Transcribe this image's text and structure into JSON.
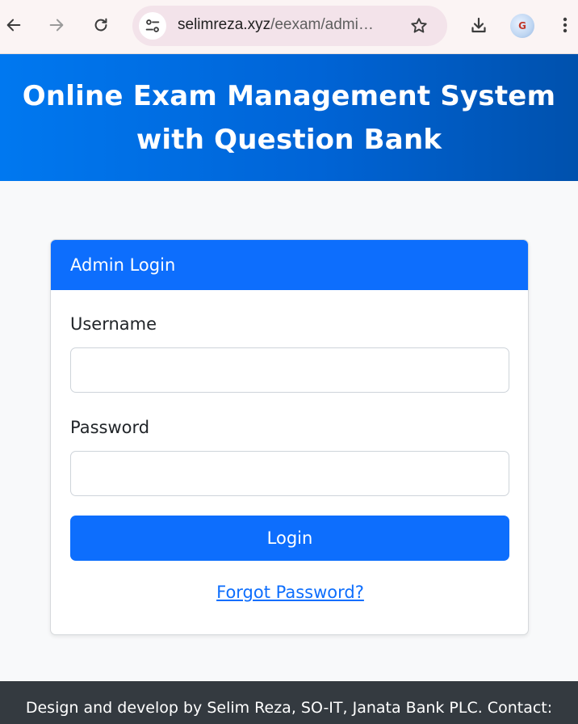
{
  "browser": {
    "url_host": "selimreza.xyz",
    "url_path": "/eexam/admi…",
    "icons": {
      "back": "arrow-left-icon",
      "forward": "arrow-right-icon",
      "reload": "reload-icon",
      "site_info": "tune-icon",
      "bookmark": "star-icon",
      "download": "download-icon",
      "extension": "extension-icon",
      "menu": "kebab-menu-icon"
    }
  },
  "header": {
    "title": "Online Exam Management System with Question Bank"
  },
  "login_card": {
    "title": "Admin Login",
    "username_label": "Username",
    "username_value": "",
    "password_label": "Password",
    "password_value": "",
    "login_button": "Login",
    "forgot_link": "Forgot Password?"
  },
  "footer": {
    "text": "Design and develop by Selim Reza, SO-IT, Janata Bank PLC. Contact:"
  },
  "colors": {
    "primary": "#0d6efd",
    "header_gradient_start": "#0078f0",
    "header_gradient_end": "#0051ad",
    "footer_bg": "#343a40",
    "page_bg": "#f8f9fa"
  }
}
